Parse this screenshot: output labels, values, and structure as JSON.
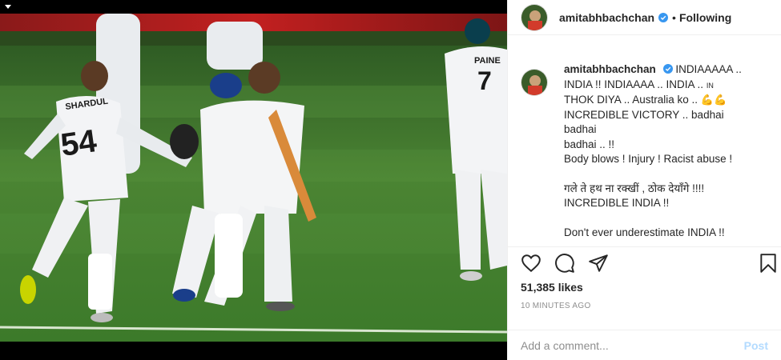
{
  "photo": {
    "jersey_left_name": "SHARDUL",
    "jersey_left_number": "54",
    "jersey_right_name": "PAINE",
    "jersey_right_number": "7",
    "top_icon": "chevron-down-icon"
  },
  "header": {
    "username": "amitabhbachchan",
    "dot": "•",
    "follow_label": "Following"
  },
  "caption": {
    "username": "amitabhbachchan",
    "line1": "INDIAAAAA ..",
    "line2": "INDIA !! INDIAAAA .. INDIA .. ",
    "line2_small": "IN",
    "line3": "THOK DIYA .. Australia ko .. ",
    "line3_emoji": "💪💪",
    "line4": "INCREDIBLE VICTORY .. badhai badhai",
    "line5": "badhai .. !!",
    "line6": "Body blows ! Injury ! Racist abuse !",
    "line7": "गले ते हथ ना रक्खीं , ठोक देयाँगे !!!!",
    "line8": "INCREDIBLE INDIA !!",
    "line9": "Don't ever underestimate INDIA !!"
  },
  "actions": {
    "icons": [
      "heart-icon",
      "comment-icon",
      "share-icon",
      "bookmark-icon"
    ]
  },
  "likes": "51,385 likes",
  "time": "10 MINUTES AGO",
  "comment": {
    "placeholder": "Add a comment...",
    "post_label": "Post",
    "post_color": "#b3dbff"
  },
  "colors": {
    "verified": "#3897f0",
    "text": "#262626",
    "muted": "#8e8e8e",
    "field": "#3f7a2c"
  }
}
